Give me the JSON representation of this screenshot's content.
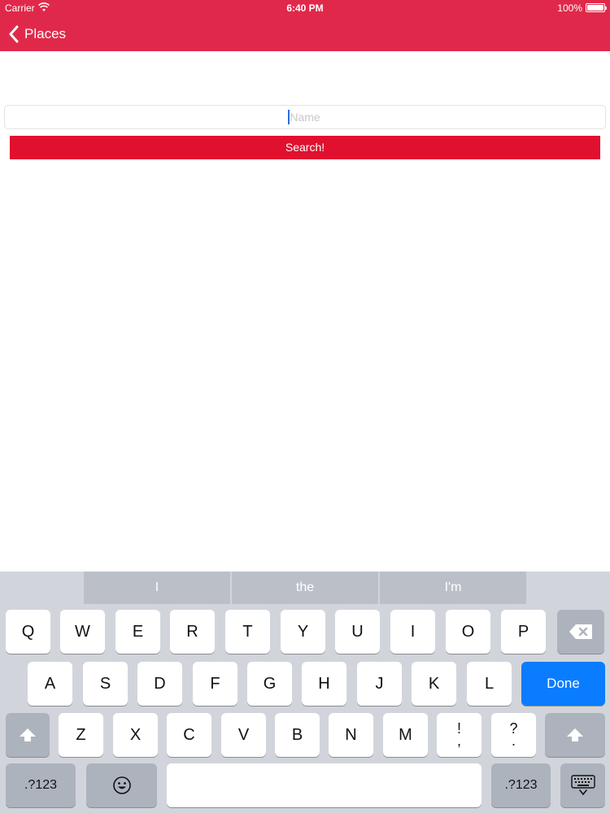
{
  "status_bar": {
    "carrier": "Carrier",
    "time": "6:40 PM",
    "battery": "100%"
  },
  "nav": {
    "back_label": "Places",
    "color": "#e0294a"
  },
  "form": {
    "name_placeholder": "Name",
    "search_label": "Search!",
    "search_color": "#e0102f"
  },
  "keyboard": {
    "suggestions": [
      "I",
      "the",
      "I'm"
    ],
    "row1": [
      "Q",
      "W",
      "E",
      "R",
      "T",
      "Y",
      "U",
      "I",
      "O",
      "P"
    ],
    "row2": [
      "A",
      "S",
      "D",
      "F",
      "G",
      "H",
      "J",
      "K",
      "L"
    ],
    "row3": [
      "Z",
      "X",
      "C",
      "V",
      "B",
      "N",
      "M"
    ],
    "punct1": {
      "top": "!",
      "bottom": ","
    },
    "punct2": {
      "top": "?",
      "bottom": "."
    },
    "done_label": "Done",
    "numbers_label": ".?123",
    "icons": [
      "backspace-icon",
      "shift-icon",
      "emoji-icon",
      "keyboard-dismiss-icon"
    ],
    "done_color": "#0a7cff"
  }
}
